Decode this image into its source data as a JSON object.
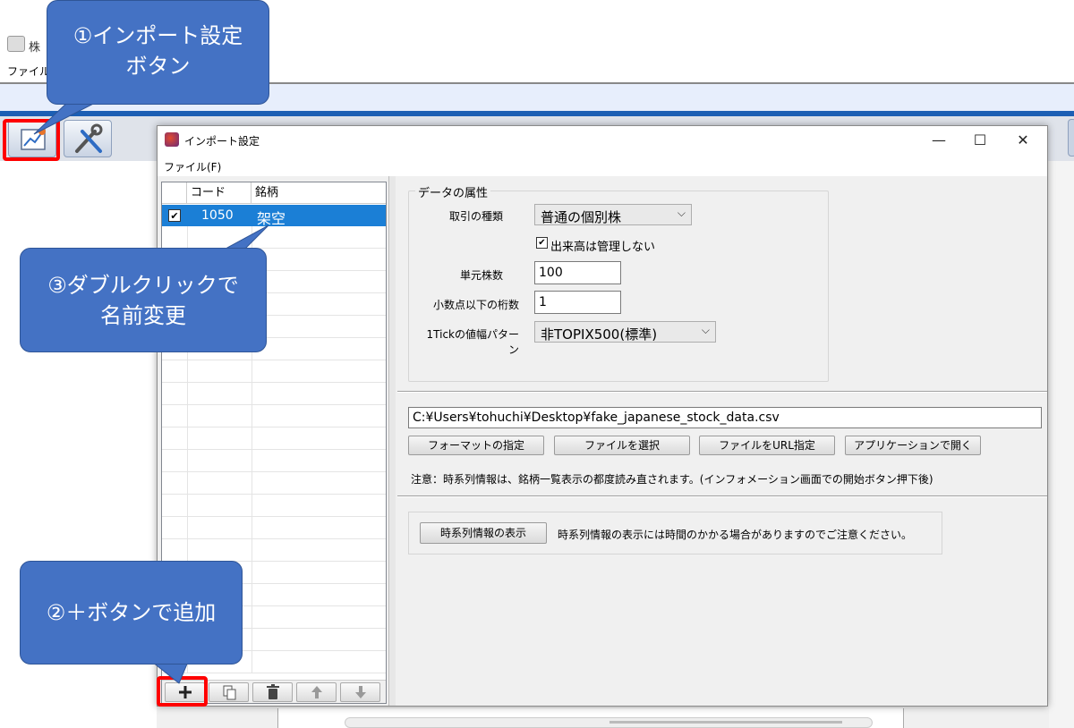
{
  "background_app": {
    "title": "株",
    "menu_file": "ファイル(F)"
  },
  "dialog": {
    "title": "インポート設定",
    "menu_file": "ファイル(F)",
    "window_controls": {
      "minimize": "—",
      "maximize": "☐",
      "close": "✕"
    },
    "list": {
      "headers": [
        "",
        "コード",
        "銘柄"
      ],
      "rows": [
        {
          "checked": true,
          "code": "1050",
          "name": "架空"
        }
      ],
      "buttons": [
        "add-icon",
        "copy-icon",
        "trash-icon",
        "arrow-up-icon",
        "arrow-down-icon"
      ]
    },
    "attributes": {
      "group_title": "データの属性",
      "trade_type_label": "取引の種類",
      "trade_type_value": "普通の個別株",
      "no_volume_label": "出来高は管理しない",
      "no_volume_checked": true,
      "unit_shares_label": "単元株数",
      "unit_shares_value": "100",
      "decimals_label": "小数点以下の桁数",
      "decimals_value": "1",
      "tick_pattern_label": "1Tickの値幅パターン",
      "tick_pattern_value": "非TOPIX500(標準)"
    },
    "file_path": "C:¥Users¥tohuchi¥Desktop¥fake_japanese_stock_data.csv",
    "buttons": {
      "format": "フォーマットの指定",
      "select_file": "ファイルを選択",
      "url": "ファイルをURL指定",
      "open_app": "アプリケーションで開く"
    },
    "note": "注意：時系列情報は、銘柄一覧表示の都度読み直されます。(インフォメーション画面での開始ボタン押下後)",
    "timeseries_button": "時系列情報の表示",
    "timeseries_note": "時系列情報の表示には時間のかかる場合がありますのでご注意ください。"
  },
  "callouts": {
    "c1_line1": "①インポート設定",
    "c1_line2": "ボタン",
    "c2": "②＋ボタンで追加",
    "c3_line1": "③ダブルクリックで",
    "c3_line2": "名前変更"
  },
  "colors": {
    "callout": "#4472c4",
    "highlight": "#ff0000",
    "selection": "#1b7fd6"
  }
}
